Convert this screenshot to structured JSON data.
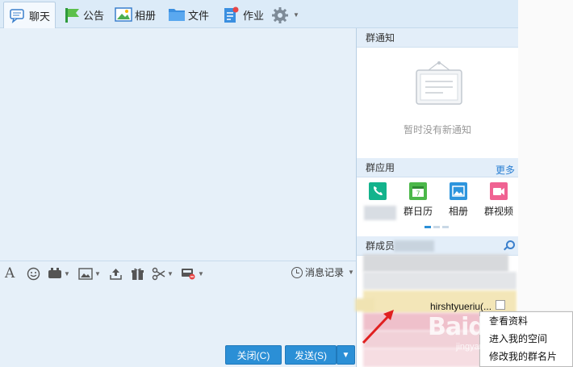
{
  "toolbar": {
    "tabs": [
      {
        "label": "聊天",
        "icon": "chat-icon"
      },
      {
        "label": "公告",
        "icon": "flag-icon"
      },
      {
        "label": "相册",
        "icon": "photo-icon"
      },
      {
        "label": "文件",
        "icon": "folder-icon"
      },
      {
        "label": "作业",
        "icon": "homework-icon"
      }
    ],
    "settings_icon": "gear-icon"
  },
  "input_tools": {
    "message_history_label": "消息记录"
  },
  "buttons": {
    "close_label": "关闭(C)",
    "send_label": "发送(S)"
  },
  "panel": {
    "notice_title": "群通知",
    "notice_empty": "暂时没有新通知",
    "apps_title": "群应用",
    "apps_more": "更多",
    "apps": [
      {
        "label": "",
        "icon": "phone-icon",
        "color": "#13b38c"
      },
      {
        "label": "群日历",
        "icon": "calendar-icon",
        "color": "#4cb84a"
      },
      {
        "label": "相册",
        "icon": "photo-icon",
        "color": "#2e95dd"
      },
      {
        "label": "群视频",
        "icon": "video-icon",
        "color": "#f06292"
      }
    ],
    "members_title": "群成员",
    "member_name": "hirshtyueriu(..."
  },
  "context_menu": {
    "items": [
      "查看资料",
      "进入我的空间",
      "修改我的群名片"
    ]
  },
  "watermark": {
    "text": "Baidu",
    "sub": "jingyan"
  },
  "colors": {
    "accent": "#2b8fd6",
    "toolbar_bg": "#dcebf8",
    "chat_bg": "#e6f0f9"
  }
}
